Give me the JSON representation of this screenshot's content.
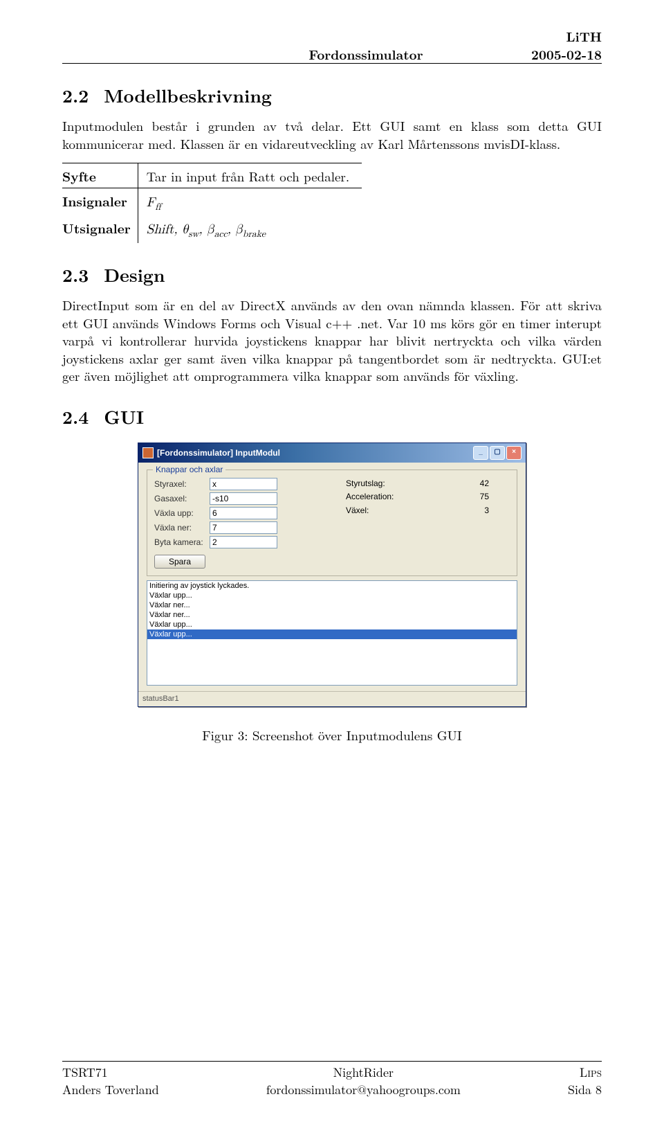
{
  "header": {
    "center": "Fordonssimulator",
    "right_top": "LiTH",
    "right_bottom": "2005-02-18"
  },
  "sec22_no": "2.2",
  "sec22_title": "Modellbeskrivning",
  "p22_intro": "Inputmodulen består i grunden av två delar. Ett GUI samt en klass som detta GUI kommunicerar med. Klassen är en vidareutveckling av Karl Mårtenssons mvisDI-klass.",
  "signal_table": {
    "r1_label": "Syfte",
    "r1_value": "Tar in input från Ratt och pedaler.",
    "r2_label": "Insignaler",
    "r2_value_html": "F_ff",
    "r3_label": "Utsignaler",
    "r3_value_html": "Shift, θ_sw, β_acc, β_brake"
  },
  "sec23_no": "2.3",
  "sec23_title": "Design",
  "p23": "DirectInput som är en del av DirectX används av den ovan nämnda klassen. För att skriva ett GUI används Windows Forms och Visual c++ .net. Var 10 ms körs gör en timer interupt varpå vi kontrollerar hurvida joystickens knappar har blivit nertryckta och vilka värden joystickens axlar ger samt även vilka knappar på tangentbordet som är nedtryckta. GUI:et ger även möjlighet att omprogrammera vilka knappar som används för växling.",
  "sec24_no": "2.4",
  "sec24_title": "GUI",
  "gui": {
    "title": "[Fordonssimulator] InputModul",
    "group_title": "Knappar och axlar",
    "left_rows": [
      {
        "label": "Styraxel:",
        "value": "x"
      },
      {
        "label": "Gasaxel:",
        "value": "-s10"
      },
      {
        "label": "Växla upp:",
        "value": "6"
      },
      {
        "label": "Växla ner:",
        "value": "7"
      },
      {
        "label": "Byta kamera:",
        "value": "2"
      }
    ],
    "right_rows": [
      {
        "label": "Styrutslag:",
        "value": "42"
      },
      {
        "label": "Acceleration:",
        "value": "75"
      },
      {
        "label": "Växel:",
        "value": "3"
      }
    ],
    "save_button": "Spara",
    "log_lines": [
      "Initiering av joystick lyckades.",
      "Växlar upp...",
      "Växlar ner...",
      "Växlar ner...",
      "Växlar upp..."
    ],
    "log_selected": "Växlar upp...",
    "status_bar": "statusBar1"
  },
  "fig_caption": "Figur 3: Screenshot över Inputmodulens GUI",
  "footer": {
    "left_top": "TSRT71",
    "left_bottom": "Anders Toverland",
    "center_top": "NightRider",
    "center_bottom": "fordonssimulator@yahoogroups.com",
    "right_top": "Lips",
    "right_bottom": "Sida 8"
  }
}
